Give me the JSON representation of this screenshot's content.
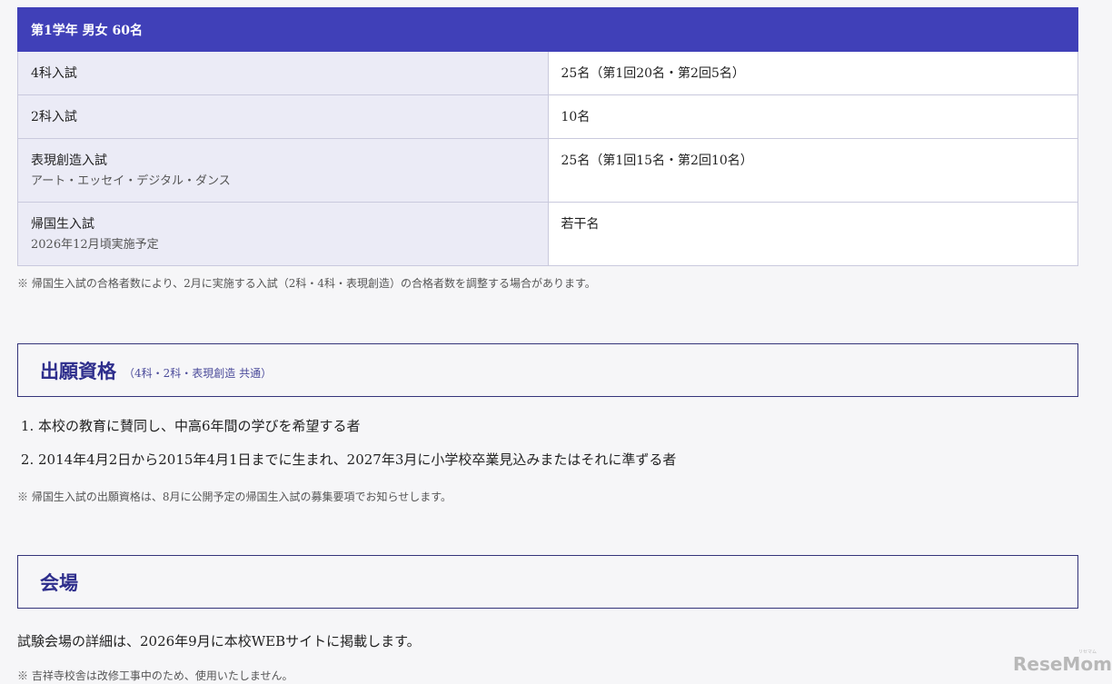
{
  "table": {
    "header": "第1学年 男女 60名",
    "rows": [
      {
        "label": "4科入試",
        "sub": "",
        "value": "25名（第1回20名・第2回5名）"
      },
      {
        "label": "2科入試",
        "sub": "",
        "value": "10名"
      },
      {
        "label": "表現創造入試",
        "sub": "アート・エッセイ・デジタル・ダンス",
        "value": "25名（第1回15名・第2回10名）"
      },
      {
        "label": "帰国生入試",
        "sub": "2026年12月頃実施予定",
        "value": "若干名"
      }
    ]
  },
  "note_quota": "※ 帰国生入試の合格者数により、2月に実施する入試（2科・4科・表現創造）の合格者数を調整する場合があります。",
  "section_eligibility": {
    "title": "出願資格",
    "subtitle": "（4科・2科・表現創造 共通）",
    "items": [
      "本校の教育に賛同し、中高6年間の学びを希望する者",
      "2014年4月2日から2015年4月1日までに生まれ、2027年3月に小学校卒業見込みまたはそれに準ずる者"
    ],
    "note": "※ 帰国生入試の出願資格は、8月に公開予定の帰国生入試の募集要項でお知らせします。"
  },
  "section_venue": {
    "title": "会場",
    "text": "試験会場の詳細は、2026年9月に本校WEBサイトに掲載します。",
    "note": "※ 吉祥寺校舎は改修工事中のため、使用いたしません。"
  },
  "watermark": {
    "logo": "ReseMom",
    "small": "リセマム"
  }
}
